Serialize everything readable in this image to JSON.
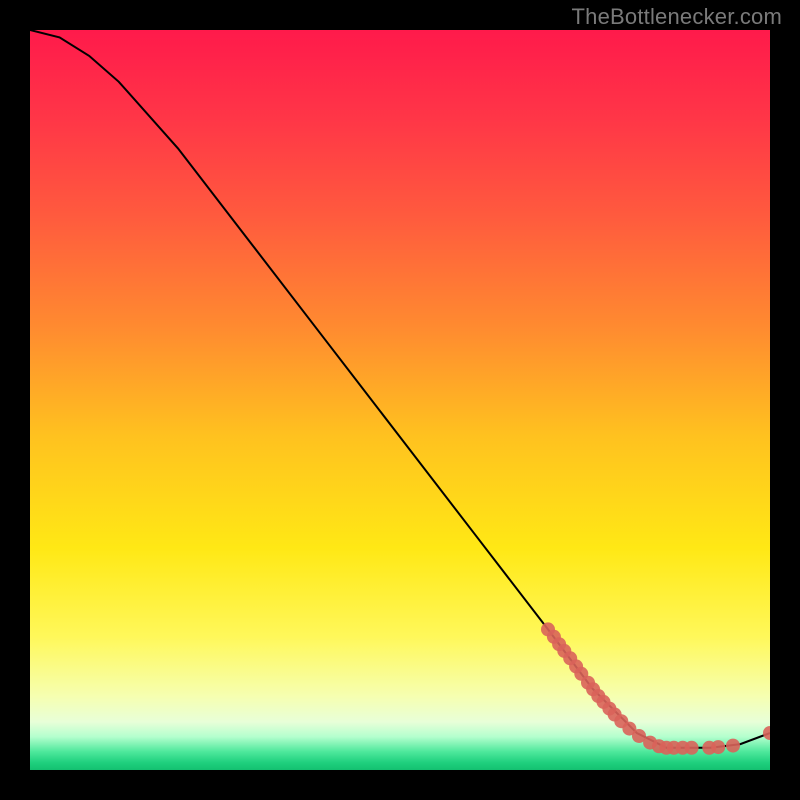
{
  "attribution": "TheBottlenecker.com",
  "chart_data": {
    "type": "line",
    "title": "",
    "xlabel": "",
    "ylabel": "",
    "xlim": [
      0,
      100
    ],
    "ylim": [
      0,
      100
    ],
    "series": [
      {
        "name": "curve",
        "style": "line",
        "color": "#000000",
        "points": [
          {
            "x": 0,
            "y": 100
          },
          {
            "x": 4,
            "y": 99
          },
          {
            "x": 8,
            "y": 96.5
          },
          {
            "x": 12,
            "y": 93
          },
          {
            "x": 20,
            "y": 84
          },
          {
            "x": 30,
            "y": 71
          },
          {
            "x": 40,
            "y": 58
          },
          {
            "x": 50,
            "y": 45
          },
          {
            "x": 60,
            "y": 32
          },
          {
            "x": 70,
            "y": 19
          },
          {
            "x": 76,
            "y": 11
          },
          {
            "x": 82,
            "y": 5
          },
          {
            "x": 86,
            "y": 3
          },
          {
            "x": 92,
            "y": 3
          },
          {
            "x": 96,
            "y": 3.5
          },
          {
            "x": 100,
            "y": 5
          }
        ]
      },
      {
        "name": "markers",
        "style": "scatter",
        "color": "#d9635a",
        "points": [
          {
            "x": 70.0,
            "y": 19.0
          },
          {
            "x": 70.8,
            "y": 18.0
          },
          {
            "x": 71.5,
            "y": 17.0
          },
          {
            "x": 72.2,
            "y": 16.1
          },
          {
            "x": 73.0,
            "y": 15.1
          },
          {
            "x": 73.8,
            "y": 14.0
          },
          {
            "x": 74.5,
            "y": 13.0
          },
          {
            "x": 75.4,
            "y": 11.8
          },
          {
            "x": 76.1,
            "y": 10.9
          },
          {
            "x": 76.8,
            "y": 10.0
          },
          {
            "x": 77.5,
            "y": 9.2
          },
          {
            "x": 78.3,
            "y": 8.3
          },
          {
            "x": 79.0,
            "y": 7.5
          },
          {
            "x": 79.9,
            "y": 6.6
          },
          {
            "x": 81.0,
            "y": 5.6
          },
          {
            "x": 82.3,
            "y": 4.6
          },
          {
            "x": 83.8,
            "y": 3.7
          },
          {
            "x": 85.0,
            "y": 3.2
          },
          {
            "x": 86.0,
            "y": 3.0
          },
          {
            "x": 87.0,
            "y": 3.0
          },
          {
            "x": 88.2,
            "y": 3.0
          },
          {
            "x": 89.4,
            "y": 3.0
          },
          {
            "x": 91.8,
            "y": 3.0
          },
          {
            "x": 93.0,
            "y": 3.1
          },
          {
            "x": 95.0,
            "y": 3.3
          },
          {
            "x": 100.0,
            "y": 5.0
          }
        ]
      }
    ],
    "gradient_stops": [
      {
        "offset": 0.0,
        "color": "#ff1a4b"
      },
      {
        "offset": 0.12,
        "color": "#ff3647"
      },
      {
        "offset": 0.25,
        "color": "#ff5a3e"
      },
      {
        "offset": 0.4,
        "color": "#ff8a30"
      },
      {
        "offset": 0.55,
        "color": "#ffc21f"
      },
      {
        "offset": 0.7,
        "color": "#ffe815"
      },
      {
        "offset": 0.82,
        "color": "#fff85a"
      },
      {
        "offset": 0.9,
        "color": "#f6ffb0"
      },
      {
        "offset": 0.935,
        "color": "#e8ffd8"
      },
      {
        "offset": 0.955,
        "color": "#b4ffce"
      },
      {
        "offset": 0.975,
        "color": "#4fe89c"
      },
      {
        "offset": 0.99,
        "color": "#1fd07e"
      },
      {
        "offset": 1.0,
        "color": "#14c070"
      }
    ]
  }
}
